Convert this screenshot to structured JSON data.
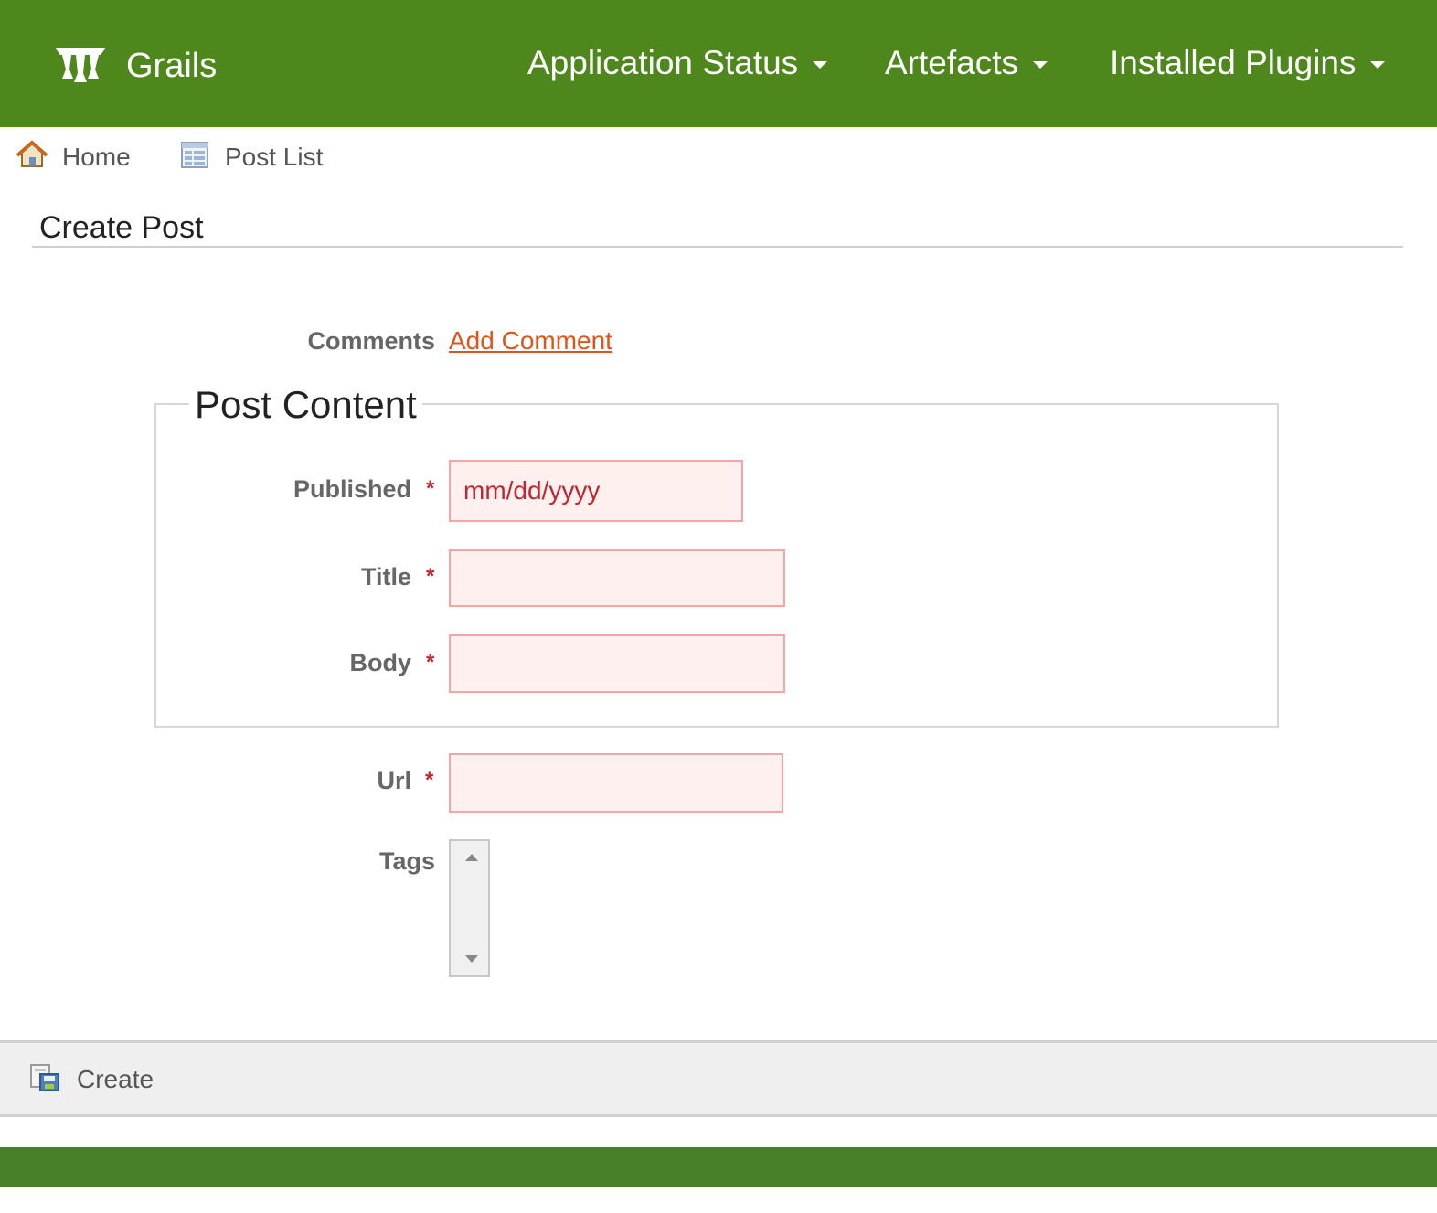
{
  "colors": {
    "nav_bg": "#4e871b",
    "footer_bg": "#4a7f2a",
    "link": "#e0541a",
    "required": "#c0262d",
    "error_field_bg": "#fff0f0",
    "error_field_border": "#f6a5a5"
  },
  "header": {
    "brand": {
      "icon": "grails-logo-icon",
      "label": "Grails"
    },
    "nav": [
      {
        "label": "Application Status",
        "icon": "caret-down-icon"
      },
      {
        "label": "Artefacts",
        "icon": "caret-down-icon"
      },
      {
        "label": "Installed Plugins",
        "icon": "caret-down-icon"
      }
    ]
  },
  "breadcrumb": [
    {
      "label": "Home",
      "icon": "home-icon"
    },
    {
      "label": "Post List",
      "icon": "list-icon"
    }
  ],
  "page": {
    "title": "Create Post"
  },
  "form": {
    "comments": {
      "label": "Comments",
      "link": "Add Comment"
    },
    "fieldset": {
      "legend": "Post Content"
    },
    "published": {
      "label": "Published",
      "required": "*",
      "placeholder": "mm/dd/yyyy"
    },
    "title": {
      "label": "Title",
      "required": "*"
    },
    "body": {
      "label": "Body",
      "required": "*"
    },
    "url": {
      "label": "Url",
      "required": "*"
    },
    "tags": {
      "label": "Tags",
      "options": []
    }
  },
  "actions": {
    "create": {
      "label": "Create",
      "icon": "save-icon"
    }
  }
}
